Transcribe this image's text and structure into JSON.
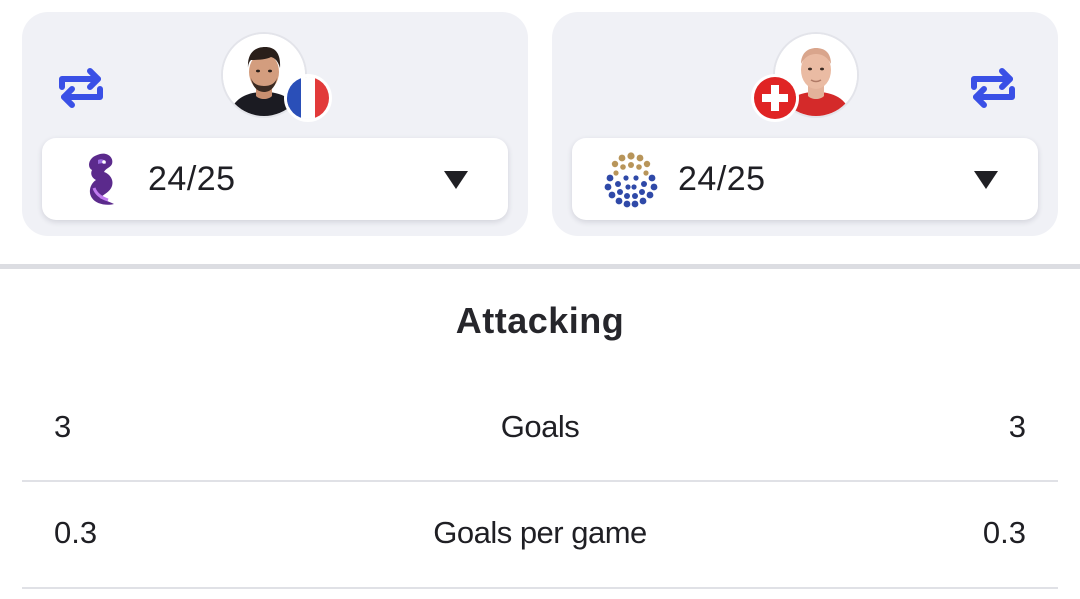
{
  "comparison": {
    "left_player": {
      "season": "24/25",
      "nationality_flag": "france-flag",
      "league_logo": "league-lion-logo"
    },
    "right_player": {
      "season": "24/25",
      "nationality_flag": "switzerland-flag",
      "league_logo": "league-dotted-ball-logo"
    }
  },
  "section": {
    "title": "Attacking"
  },
  "stats": [
    {
      "label": "Goals",
      "left": "3",
      "right": "3"
    },
    {
      "label": "Goals per game",
      "left": "0.3",
      "right": "0.3"
    }
  ],
  "colors": {
    "accent": "#3a50e6",
    "card_bg": "#f0f1f6",
    "divider": "#dcdde2"
  }
}
